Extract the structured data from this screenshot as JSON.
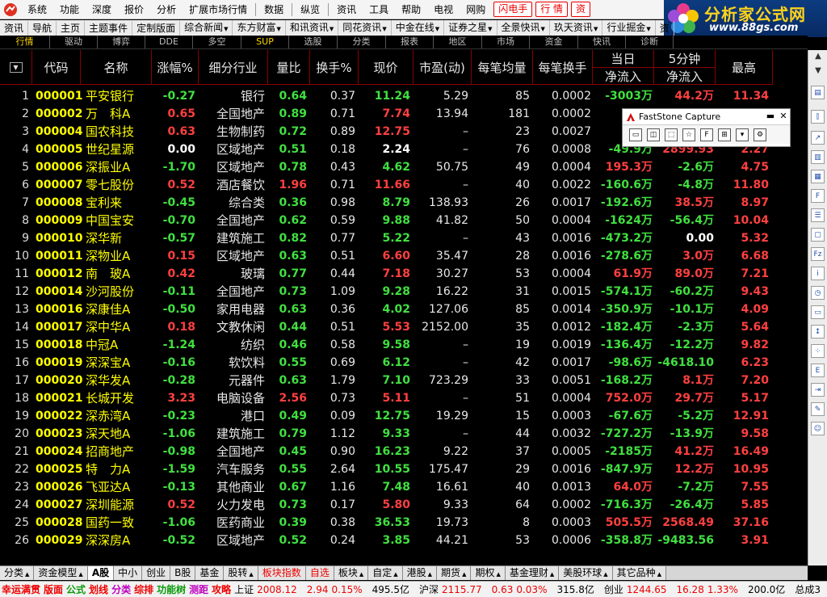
{
  "menu": {
    "items": [
      "系统",
      "功能",
      "深度",
      "报价",
      "分析",
      "扩展市场行情",
      "数据",
      "纵览",
      "资讯",
      "工具",
      "帮助",
      "电视",
      "网购"
    ],
    "buttons": [
      "闪电手",
      "行 情",
      "资"
    ]
  },
  "logo": {
    "title": "分析家公式网",
    "url": "www.88gs.com"
  },
  "toolbar": [
    "资讯",
    "导航",
    "主页",
    "主题事件",
    "定制版面",
    "综合新闻",
    "东方财富",
    "和讯资讯",
    "同花资讯",
    "中金在线",
    "证券之星",
    "全景快讯",
    "玖天资讯",
    "行业掘金",
    "资"
  ],
  "subtabs": [
    "行情",
    "驱动",
    "博弈",
    "DDE",
    "多空",
    "SUP",
    "选股",
    "分类",
    "报表",
    "地区",
    "市场",
    "资金",
    "快讯",
    "诊断"
  ],
  "table": {
    "headers": {
      "code": "代码",
      "name": "名称",
      "change": "涨幅%",
      "industry": "细分行业",
      "vol_ratio": "量比",
      "turnover": "换手%",
      "price": "现价",
      "pe": "市盈(动)",
      "avg_per_trade": "每笔均量",
      "turnover_per_trade": "每笔换手",
      "flow_day_top": "当日",
      "flow_day_bottom": "净流入",
      "flow_5m_top": "5分钟",
      "flow_5m_bottom": "净流入",
      "high": "最高"
    },
    "rows": [
      {
        "idx": "1",
        "code": "000001",
        "name": "平安银行",
        "chg": "-0.27",
        "ind": "银行",
        "vr": "0.64",
        "turn": "0.37",
        "price": "11.24",
        "pe": "5.29",
        "avg": "85",
        "tpt": "0.0002",
        "flow": "-3003万",
        "flow5": "44.2万",
        "high": "11.34"
      },
      {
        "idx": "2",
        "code": "000002",
        "name": "万　科A",
        "chg": "0.65",
        "ind": "全国地产",
        "vr": "0.89",
        "turn": "0.71",
        "price": "7.74",
        "pe": "13.94",
        "avg": "181",
        "tpt": "0.0002",
        "flow": "6",
        "flow5": "",
        "high": ""
      },
      {
        "idx": "3",
        "code": "000004",
        "name": "国农科技",
        "chg": "0.63",
        "ind": "生物制药",
        "vr": "0.72",
        "turn": "0.89",
        "price": "12.75",
        "pe": "–",
        "avg": "23",
        "tpt": "0.0027",
        "flow": "-15",
        "flow5": "",
        "high": ""
      },
      {
        "idx": "4",
        "code": "000005",
        "name": "世纪星源",
        "chg": "0.00",
        "ind": "区域地产",
        "vr": "0.51",
        "turn": "0.18",
        "price": "2.24",
        "pe": "–",
        "avg": "76",
        "tpt": "0.0008",
        "flow": "-49.9万",
        "flow5": "2899.93",
        "high": "2.27"
      },
      {
        "idx": "5",
        "code": "000006",
        "name": "深振业A",
        "chg": "-1.70",
        "ind": "区域地产",
        "vr": "0.78",
        "turn": "0.43",
        "price": "4.62",
        "pe": "50.75",
        "avg": "49",
        "tpt": "0.0004",
        "flow": "195.3万",
        "flow5": "-2.6万",
        "high": "4.75"
      },
      {
        "idx": "6",
        "code": "000007",
        "name": "零七股份",
        "chg": "0.52",
        "ind": "酒店餐饮",
        "vr": "1.96",
        "turn": "0.71",
        "price": "11.66",
        "pe": "–",
        "avg": "40",
        "tpt": "0.0022",
        "flow": "-160.6万",
        "flow5": "-4.8万",
        "high": "11.80"
      },
      {
        "idx": "7",
        "code": "000008",
        "name": "宝利来",
        "chg": "-0.45",
        "ind": "综合类",
        "vr": "0.36",
        "turn": "0.98",
        "price": "8.79",
        "pe": "138.93",
        "avg": "26",
        "tpt": "0.0017",
        "flow": "-192.6万",
        "flow5": "38.5万",
        "high": "8.97"
      },
      {
        "idx": "8",
        "code": "000009",
        "name": "中国宝安",
        "chg": "-0.70",
        "ind": "全国地产",
        "vr": "0.62",
        "turn": "0.59",
        "price": "9.88",
        "pe": "41.82",
        "avg": "50",
        "tpt": "0.0004",
        "flow": "-1624万",
        "flow5": "-56.4万",
        "high": "10.04"
      },
      {
        "idx": "9",
        "code": "000010",
        "name": "深华新",
        "chg": "-0.57",
        "ind": "建筑施工",
        "vr": "0.82",
        "turn": "0.77",
        "price": "5.22",
        "pe": "–",
        "avg": "43",
        "tpt": "0.0016",
        "flow": "-473.2万",
        "flow5": "0.00",
        "high": "5.32"
      },
      {
        "idx": "10",
        "code": "000011",
        "name": "深物业A",
        "chg": "0.15",
        "ind": "区域地产",
        "vr": "0.63",
        "turn": "0.51",
        "price": "6.60",
        "pe": "35.47",
        "avg": "28",
        "tpt": "0.0016",
        "flow": "-278.6万",
        "flow5": "3.0万",
        "high": "6.68"
      },
      {
        "idx": "11",
        "code": "000012",
        "name": "南　玻A",
        "chg": "0.42",
        "ind": "玻璃",
        "vr": "0.77",
        "turn": "0.44",
        "price": "7.18",
        "pe": "30.27",
        "avg": "53",
        "tpt": "0.0004",
        "flow": "61.9万",
        "flow5": "89.0万",
        "high": "7.21"
      },
      {
        "idx": "12",
        "code": "000014",
        "name": "沙河股份",
        "chg": "-0.11",
        "ind": "全国地产",
        "vr": "0.73",
        "turn": "1.09",
        "price": "9.28",
        "pe": "16.22",
        "avg": "31",
        "tpt": "0.0015",
        "flow": "-574.1万",
        "flow5": "-60.2万",
        "high": "9.43"
      },
      {
        "idx": "13",
        "code": "000016",
        "name": "深康佳A",
        "chg": "-0.50",
        "ind": "家用电器",
        "vr": "0.63",
        "turn": "0.36",
        "price": "4.02",
        "pe": "127.06",
        "avg": "85",
        "tpt": "0.0014",
        "flow": "-350.9万",
        "flow5": "-10.1万",
        "high": "4.09"
      },
      {
        "idx": "14",
        "code": "000017",
        "name": "深中华A",
        "chg": "0.18",
        "ind": "文教休闲",
        "vr": "0.44",
        "turn": "0.51",
        "price": "5.53",
        "pe": "2152.00",
        "avg": "35",
        "tpt": "0.0012",
        "flow": "-182.4万",
        "flow5": "-2.3万",
        "high": "5.64"
      },
      {
        "idx": "15",
        "code": "000018",
        "name": "中冠A",
        "chg": "-1.24",
        "ind": "纺织",
        "vr": "0.46",
        "turn": "0.58",
        "price": "9.58",
        "pe": "–",
        "avg": "19",
        "tpt": "0.0019",
        "flow": "-136.4万",
        "flow5": "-12.2万",
        "high": "9.82"
      },
      {
        "idx": "16",
        "code": "000019",
        "name": "深深宝A",
        "chg": "-0.16",
        "ind": "软饮料",
        "vr": "0.55",
        "turn": "0.69",
        "price": "6.12",
        "pe": "–",
        "avg": "42",
        "tpt": "0.0017",
        "flow": "-98.6万",
        "flow5": "-4618.10",
        "high": "6.23"
      },
      {
        "idx": "17",
        "code": "000020",
        "name": "深华发A",
        "chg": "-0.28",
        "ind": "元器件",
        "vr": "0.63",
        "turn": "1.79",
        "price": "7.10",
        "pe": "723.29",
        "avg": "33",
        "tpt": "0.0051",
        "flow": "-168.2万",
        "flow5": "8.1万",
        "high": "7.20"
      },
      {
        "idx": "18",
        "code": "000021",
        "name": "长城开发",
        "chg": "3.23",
        "ind": "电脑设备",
        "vr": "2.56",
        "turn": "0.73",
        "price": "5.11",
        "pe": "–",
        "avg": "51",
        "tpt": "0.0004",
        "flow": "752.0万",
        "flow5": "29.7万",
        "high": "5.17"
      },
      {
        "idx": "19",
        "code": "000022",
        "name": "深赤湾A",
        "chg": "-0.23",
        "ind": "港口",
        "vr": "0.49",
        "turn": "0.09",
        "price": "12.75",
        "pe": "19.29",
        "avg": "15",
        "tpt": "0.0003",
        "flow": "-67.6万",
        "flow5": "-5.2万",
        "high": "12.91"
      },
      {
        "idx": "20",
        "code": "000023",
        "name": "深天地A",
        "chg": "-1.06",
        "ind": "建筑施工",
        "vr": "0.79",
        "turn": "1.12",
        "price": "9.33",
        "pe": "–",
        "avg": "44",
        "tpt": "0.0032",
        "flow": "-727.2万",
        "flow5": "-13.9万",
        "high": "9.58"
      },
      {
        "idx": "21",
        "code": "000024",
        "name": "招商地产",
        "chg": "-0.98",
        "ind": "全国地产",
        "vr": "0.45",
        "turn": "0.90",
        "price": "16.23",
        "pe": "9.22",
        "avg": "37",
        "tpt": "0.0005",
        "flow": "-2185万",
        "flow5": "41.2万",
        "high": "16.49"
      },
      {
        "idx": "22",
        "code": "000025",
        "name": "特　力A",
        "chg": "-1.59",
        "ind": "汽车服务",
        "vr": "0.55",
        "turn": "2.64",
        "price": "10.55",
        "pe": "175.47",
        "avg": "29",
        "tpt": "0.0016",
        "flow": "-847.9万",
        "flow5": "12.2万",
        "high": "10.95"
      },
      {
        "idx": "23",
        "code": "000026",
        "name": "飞亚达A",
        "chg": "-0.13",
        "ind": "其他商业",
        "vr": "0.67",
        "turn": "1.16",
        "price": "7.48",
        "pe": "16.61",
        "avg": "40",
        "tpt": "0.0013",
        "flow": "64.0万",
        "flow5": "-7.2万",
        "high": "7.55"
      },
      {
        "idx": "24",
        "code": "000027",
        "name": "深圳能源",
        "chg": "0.52",
        "ind": "火力发电",
        "vr": "0.73",
        "turn": "0.17",
        "price": "5.80",
        "pe": "9.33",
        "avg": "64",
        "tpt": "0.0002",
        "flow": "-716.3万",
        "flow5": "-26.4万",
        "high": "5.85"
      },
      {
        "idx": "25",
        "code": "000028",
        "name": "国药一致",
        "chg": "-1.06",
        "ind": "医药商业",
        "vr": "0.39",
        "turn": "0.38",
        "price": "36.53",
        "pe": "19.73",
        "avg": "8",
        "tpt": "0.0003",
        "flow": "505.5万",
        "flow5": "2568.49",
        "high": "37.16"
      },
      {
        "idx": "26",
        "code": "000029",
        "name": "深深房A",
        "chg": "-0.52",
        "ind": "区域地产",
        "vr": "0.52",
        "turn": "0.24",
        "price": "3.85",
        "pe": "44.21",
        "avg": "53",
        "tpt": "0.0006",
        "flow": "-358.8万",
        "flow5": "-9483.56",
        "high": "3.91"
      }
    ]
  },
  "faststone": {
    "title": "FastStone Capture"
  },
  "bottom_tabs": [
    {
      "label": "分类",
      "drop": true
    },
    {
      "label": "资金模型",
      "drop": true
    },
    {
      "label": "A股",
      "active": true
    },
    {
      "label": "中小"
    },
    {
      "label": "创业"
    },
    {
      "label": "B股"
    },
    {
      "label": "基金"
    },
    {
      "label": "股转",
      "drop": true
    },
    {
      "label": "板块指数",
      "red": true
    },
    {
      "label": "自选",
      "red": true
    },
    {
      "label": "板块",
      "drop": true
    },
    {
      "label": "自定",
      "drop": true
    },
    {
      "label": "港股",
      "drop": true
    },
    {
      "label": "期货",
      "drop": true
    },
    {
      "label": "期权",
      "drop": true
    },
    {
      "label": "基金理财",
      "drop": true
    },
    {
      "label": "美股环球",
      "drop": true
    },
    {
      "label": "其它品种",
      "drop": true
    }
  ],
  "status": {
    "items": [
      "幸运满贯",
      "版面",
      "公式",
      "划线",
      "分类",
      "综排",
      "功能树",
      "测距",
      "攻略"
    ],
    "sh_label": "上证",
    "sh_value": "2008.12",
    "sh_change": "2.94",
    "sh_pct": "0.15%",
    "sh_amount": "495.5亿",
    "sz_label": "沪深",
    "sz_value": "2115.77",
    "sz_change": "0.63",
    "sz_pct": "0.03%",
    "sz_amount": "315.8亿",
    "cy_label": "创业",
    "cy_value": "1244.65",
    "cy_change": "16.28",
    "cy_pct": "1.33%",
    "cy_amount": "200.0亿",
    "tail": "总成3"
  },
  "colors": {
    "up": "#ff4040",
    "down": "#40e040",
    "code": "#ffff00",
    "grid_border": "#800000"
  }
}
